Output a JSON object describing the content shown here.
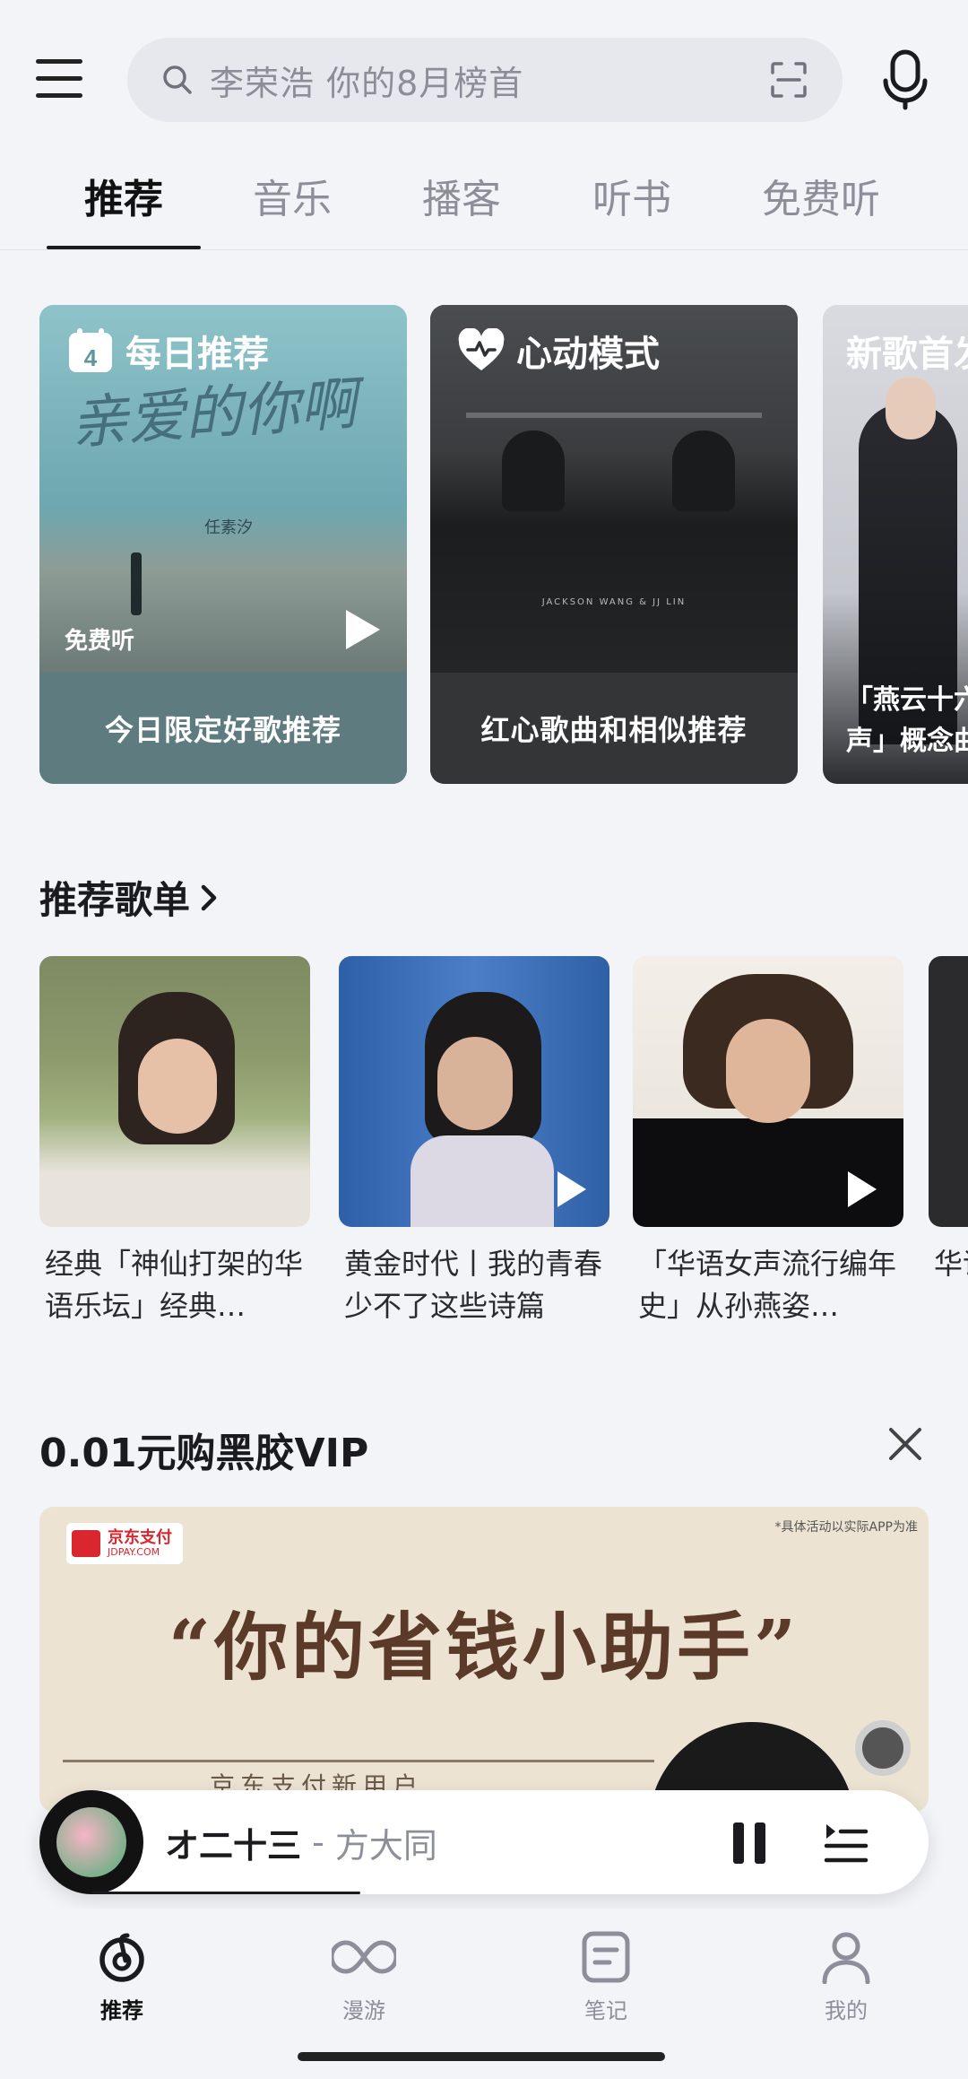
{
  "header": {
    "search_placeholder": "李荣浩 你的8月榜首"
  },
  "tabs": [
    {
      "label": "推荐",
      "active": true
    },
    {
      "label": "音乐",
      "active": false
    },
    {
      "label": "播客",
      "active": false
    },
    {
      "label": "听书",
      "active": false
    },
    {
      "label": "免费听",
      "active": false
    }
  ],
  "feature_cards": [
    {
      "title": "每日推荐",
      "calendar_day": "4",
      "badge": "免费听",
      "caption": "今日限定好歌推荐",
      "cover_text": "亲爱的你啊",
      "cover_artist": "任素汐"
    },
    {
      "title": "心动模式",
      "caption": "红心歌曲和相似推荐",
      "cover_text": "JACKSON WANG & JJ LIN"
    },
    {
      "title": "新歌首发",
      "caption": "「燕云十六声」概念曲"
    }
  ],
  "playlists_section": {
    "title": "推荐歌单",
    "items": [
      {
        "title": "经典「神仙打架的华语乐坛」经典…"
      },
      {
        "title": "黄金时代丨我的青春少不了这些诗篇"
      },
      {
        "title": "「华语女声流行编年史」从孙燕姿…"
      },
      {
        "title": "华语女力"
      }
    ]
  },
  "ad_section": {
    "title": "0.01元购黑胶VIP",
    "brand": "京东支付",
    "brand_sub": "JDPAY.COM",
    "disclaimer": "*具体活动以实际APP为准",
    "headline": "“你的省钱小助手”",
    "subline": "京东支付新用户"
  },
  "now_playing": {
    "song": "オ二十三",
    "separator": " - ",
    "artist": "方大同"
  },
  "bottom_nav": [
    {
      "label": "推荐",
      "active": true
    },
    {
      "label": "漫游",
      "active": false
    },
    {
      "label": "笔记",
      "active": false
    },
    {
      "label": "我的",
      "active": false
    }
  ],
  "colors": {
    "background": "#f2f4f8",
    "accent": "#1b1b1f",
    "muted": "#8c8f99"
  }
}
